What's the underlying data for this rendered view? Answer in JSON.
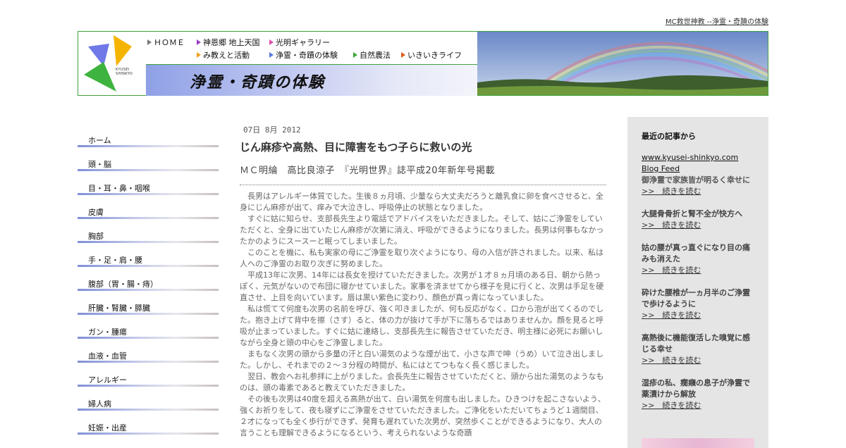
{
  "top_link": "MC救世神教 --浄霊・奇蹟の体験",
  "logo": {
    "line1": "KYUSEI",
    "line2": "SHINKYO"
  },
  "nav": [
    {
      "label": "ＨＯＭＥ",
      "color": "#777777"
    },
    {
      "label": "神恩郷 地上天国",
      "color": "#9b3fbf"
    },
    {
      "label": "光明ギャラリー",
      "color": "#e04fb0"
    },
    {
      "label": "み教えと活動",
      "color": "#f0a020"
    },
    {
      "label": "浄霊・奇蹟の体験",
      "color": "#5a78e0"
    },
    {
      "label": "自然農法",
      "color": "#3aa83a"
    },
    {
      "label": "いきいきライフ",
      "color": "#e05a1a"
    }
  ],
  "banner_title": "浄霊・奇蹟の体験",
  "sidebar": [
    "ホーム",
    "頭・脳",
    "目・耳・鼻・咽喉",
    "皮膚",
    "胸部",
    "手・足・肩・腰",
    "腹部（胃・腸・痔）",
    "肝臓・腎臓・膵臓",
    "ガン・腫瘍",
    "血液・血管",
    "アレルギー",
    "婦人病",
    "妊娠・出産"
  ],
  "post": {
    "date": "07日 8月 2012",
    "title": "じん麻疹や高熱、目に障害をもつ子らに救いの光",
    "byline": "ＭＣ明綸　高比良涼子　『光明世界』誌平成20年新年号掲載",
    "paragraphs": [
      "長男はアレルギー体質でした。生後８ヵ月頃、少量なら大丈夫だろうと離乳食に卵を食べさせると、全身にじん麻疹が出て、痒みで大泣きし、呼吸停止の状態となりました。",
      "すぐに姑に知らせ、支部長先生より電話でアドバイスをいただきました。そして、姑にご浄霊をしていただくと、全身に出ていたじん麻疹が次第に消え、呼吸ができるようになりました。長男は何事もなかったかのようにスースーと眠ってしまいました。",
      "このことを機に、私も実家の母にご浄霊を取り次ぐようになり、母の入信が許されました。以来、私は人へのご浄霊のお取り次ぎに努めました。",
      "平成13年に次男、14年には長女を授けていただきました。次男が１才８ヵ月頃のある日、朝から熱っぽく、元気がないので布団に寝かせていました。家事を済ませてから様子を見に行くと、次男は手足を硬直させ、上目を向いています。唇は黒い紫色に変わり、顔色が真っ青になっていました。",
      "私は慌てて何度も次男の名前を呼び、強く叩きましたが、何も反応がなく、口から泡が出てくるのでした。抱き上げて背中を擦（さす）ると、体の力が抜けて手が下に落ちるではありませんか。顔を見ると呼吸が止まっていました。すぐに姑に連絡し、支部長先生に報告させていただき、明主様に必死にお願いしながら全身と頭の中心をご浄霊しました。",
      "まもなく次男の頭から多量の汗と白い湯気のような煙が出て、小さな声で呻（うめ）いて泣き出しました。しかし、それまでの２～３分程の時間が、私にはとてつもなく長く感じました。",
      "翌日、教会へお礼参拝に上がりました。会長先生に報告させていただくと、頭から出た湯気のようなものは、頭の毒素であると教えていただきました。",
      "その後も次男は40度を超える高熱が出て、白い湯気を何度も出しました。ひきつけを起こさないよう、強くお祈りをして、夜も寝ずにご浄霊をさせていただきました。ご浄化をいただいてちょうど１週間目、２才になっても全く歩行ができず、発育も遅れていた次男が、突然歩くことができるようになり、大人の言うことも理解できるようになるという、考えられないような奇蹟"
    ]
  },
  "recent": {
    "heading": "最近の記事から",
    "links": [
      "www.kyusei-shinkyo.com",
      "Blog Feed"
    ],
    "more_label": ">>　続きを読む",
    "articles": [
      "御浄霊で家族皆が明るく幸せに",
      "大腿骨骨折と腎不全が快方へ",
      "姑の腰が真っ直ぐになり目の痛みも消えた",
      "砕けた腰椎が一ヵ月半のご浄霊で歩けるように",
      "高熱後に機能復活した嗅覚に感じる幸せ",
      "湿疹の私、癇癪の息子が浄霊で薬漬けから解放"
    ]
  }
}
